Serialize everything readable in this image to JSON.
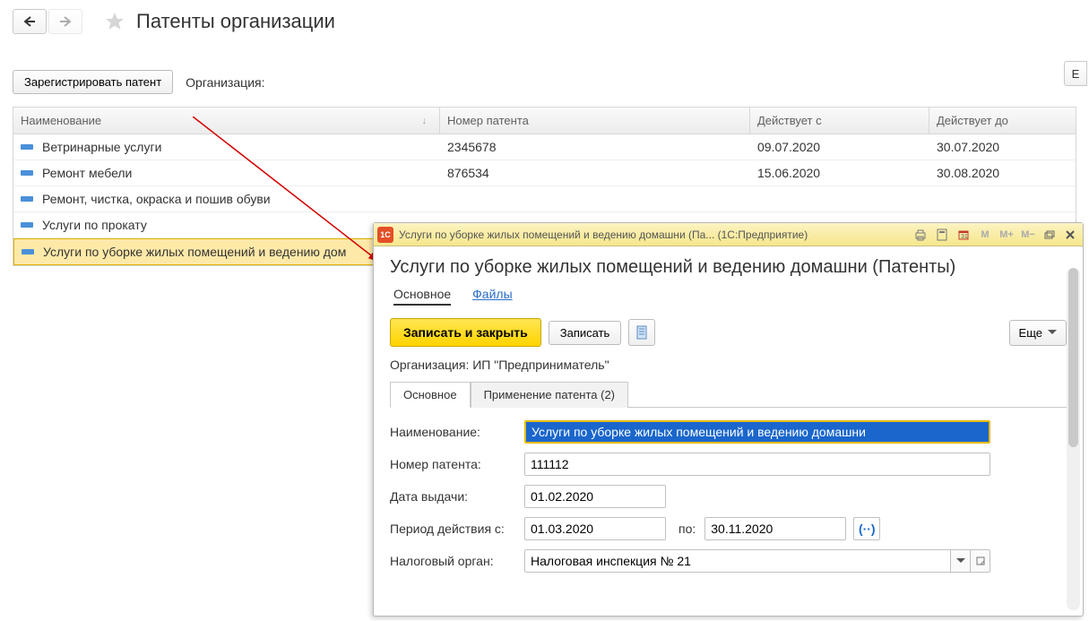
{
  "header": {
    "title": "Патенты организации"
  },
  "cmdbar": {
    "register_btn": "Зарегистрировать патент",
    "org_label": "Организация:",
    "right_stub": "Е"
  },
  "grid": {
    "columns": {
      "name": "Наименование",
      "number": "Номер патента",
      "from": "Действует с",
      "to": "Действует до"
    },
    "rows": [
      {
        "name": "Ветринарные услуги",
        "number": "2345678",
        "from": "09.07.2020",
        "to": "30.07.2020",
        "sel": false
      },
      {
        "name": "Ремонт мебели",
        "number": "876534",
        "from": "15.06.2020",
        "to": "30.08.2020",
        "sel": false
      },
      {
        "name": "Ремонт, чистка, окраска и пошив обуви",
        "number": "",
        "from": "",
        "to": "",
        "sel": false
      },
      {
        "name": "Услуги по прокату",
        "number": "",
        "from": "",
        "to": "",
        "sel": false
      },
      {
        "name": "Услуги по уборке жилых помещений и ведению дом",
        "number": "",
        "from": "",
        "to": "",
        "sel": true
      }
    ]
  },
  "modal": {
    "titlebar_text": "Услуги по уборке жилых помещений и ведению домашни (Па...   (1С:Предприятие)",
    "heading": "Услуги по уборке жилых помещений и ведению домашни (Патенты)",
    "nav": {
      "tab_main": "Основное",
      "tab_files": "Файлы"
    },
    "actions": {
      "save_close": "Записать и закрыть",
      "save": "Записать",
      "more": "Еще"
    },
    "org_label": "Организация:",
    "org_value": "ИП \"Предприниматель\"",
    "tabs": {
      "main": "Основное",
      "usage": "Применение патента (2)"
    },
    "form": {
      "name_label": "Наименование:",
      "name_value": "Услуги по уборке жилых помещений и ведению домашни",
      "number_label": "Номер патента:",
      "number_value": "111112",
      "issue_label": "Дата выдачи:",
      "issue_value": "01.02.2020",
      "period_label": "Период действия с:",
      "period_from": "01.03.2020",
      "period_to_label": "по:",
      "period_to": "30.11.2020",
      "tax_label": "Налоговый орган:",
      "tax_value": "Налоговая инспекция № 21"
    }
  }
}
